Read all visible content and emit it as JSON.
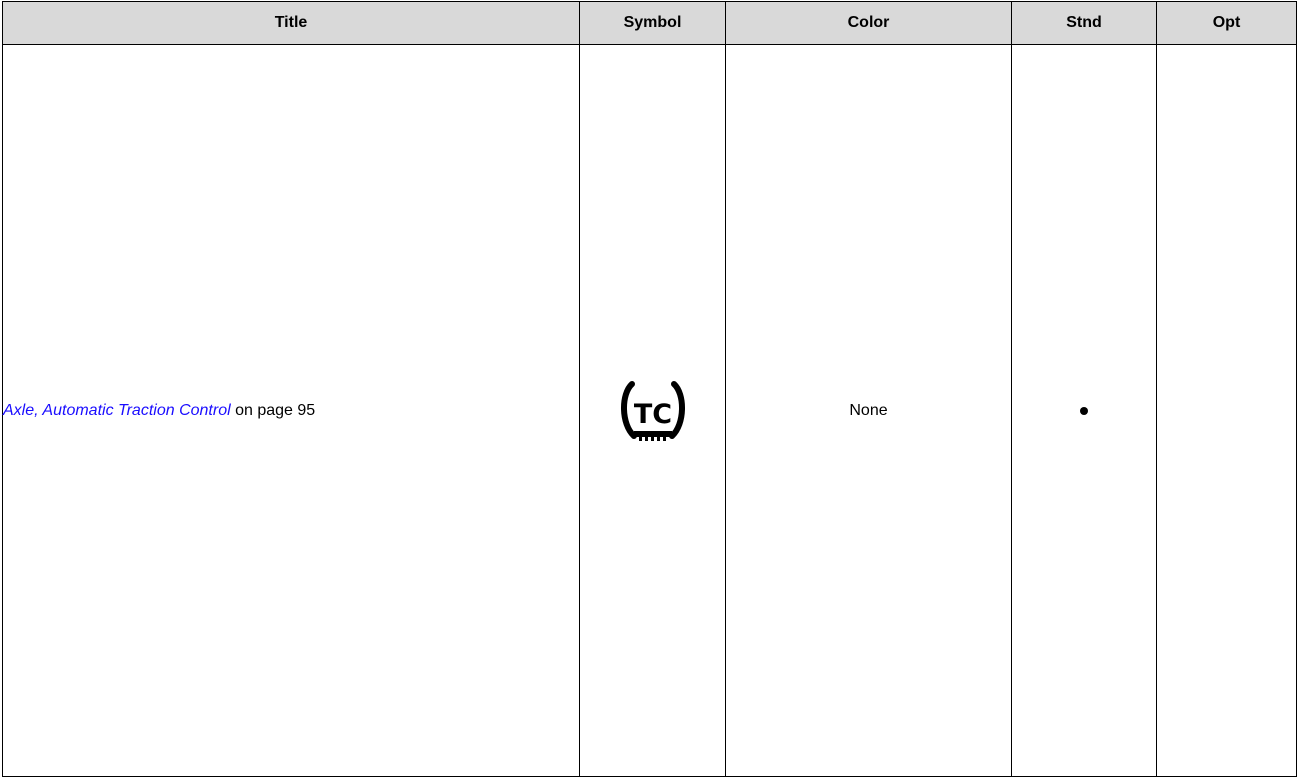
{
  "table": {
    "headers": {
      "title": "Title",
      "symbol": "Symbol",
      "color": "Color",
      "stnd": "Stnd",
      "opt": "Opt"
    },
    "rows": [
      {
        "title_link": "Axle, Automatic Traction Control",
        "title_suffix": " on page 95",
        "symbol_icon": "traction-control-icon",
        "symbol_text": "TC",
        "color": "None",
        "stnd": "bullet",
        "opt": ""
      }
    ]
  },
  "colors": {
    "header_bg": "#d9d9d9",
    "link": "#1a0dff",
    "border": "#000000"
  }
}
